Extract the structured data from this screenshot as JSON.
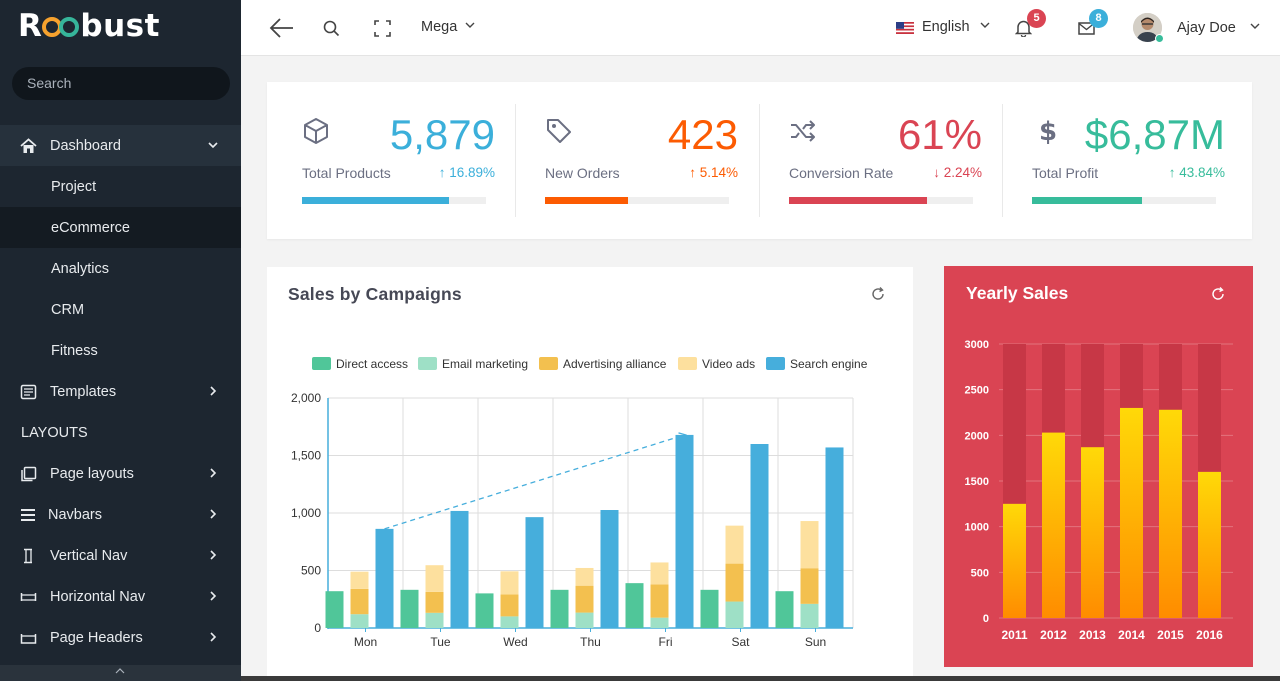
{
  "brand": {
    "logo_text_prefix": "R",
    "logo_text_suffix": "bust"
  },
  "sidebar": {
    "search_placeholder": "Search",
    "items": [
      {
        "label": "Dashboard",
        "icon": "home-icon",
        "chevron": "down"
      },
      {
        "label": "Project"
      },
      {
        "label": "eCommerce",
        "active": true
      },
      {
        "label": "Analytics"
      },
      {
        "label": "CRM"
      },
      {
        "label": "Fitness"
      },
      {
        "label": "Templates",
        "icon": "templates-icon",
        "chevron": "right"
      },
      {
        "label": "LAYOUTS",
        "category": true
      },
      {
        "label": "Page layouts",
        "icon": "copy-icon",
        "chevron": "right"
      },
      {
        "label": "Navbars",
        "icon": "menu-icon",
        "chevron": "right"
      },
      {
        "label": "Vertical Nav",
        "icon": "vertical-nav-icon",
        "chevron": "right"
      },
      {
        "label": "Horizontal Nav",
        "icon": "horizontal-nav-icon",
        "chevron": "right"
      },
      {
        "label": "Page Headers",
        "icon": "page-headers-icon",
        "chevron": "right"
      }
    ]
  },
  "header": {
    "mega_label": "Mega",
    "language": "English",
    "notifications_count": "5",
    "messages_count": "8",
    "user_name": "Ajay Doe"
  },
  "stats": [
    {
      "value": "5,879",
      "label": "Total Products",
      "change": "16.89%",
      "direction": "up",
      "color": "#3bafda",
      "progress": 0.8,
      "icon": "cube-icon"
    },
    {
      "value": "423",
      "label": "New Orders",
      "change": "5.14%",
      "direction": "up",
      "color": "#fc5b02",
      "progress": 0.45,
      "icon": "tag-icon"
    },
    {
      "value": "61%",
      "label": "Conversion Rate",
      "change": "2.24%",
      "direction": "down",
      "color": "#da4453",
      "progress": 0.75,
      "icon": "shuffle-icon"
    },
    {
      "value": "$6,87M",
      "label": "Total Profit",
      "change": "43.84%",
      "direction": "up",
      "color": "#37bc9b",
      "progress": 0.6,
      "icon": "dollar-icon"
    }
  ],
  "campaigns": {
    "title": "Sales by Campaigns",
    "chart_data": {
      "type": "bar",
      "categories": [
        "Mon",
        "Tue",
        "Wed",
        "Thu",
        "Fri",
        "Sat",
        "Sun"
      ],
      "series": [
        {
          "name": "Direct access",
          "color": "#50c699",
          "values": [
            320,
            332,
            301,
            332,
            390,
            332,
            320
          ]
        },
        {
          "name": "Email marketing",
          "color": "#9ee0c6",
          "values": [
            120,
            132,
            101,
            134,
            90,
            230,
            210
          ]
        },
        {
          "name": "Advertising alliance",
          "color": "#f3c04f",
          "values": [
            220,
            182,
            191,
            234,
            290,
            330,
            310
          ]
        },
        {
          "name": "Video ads",
          "color": "#fde09e",
          "values": [
            150,
            232,
            201,
            154,
            190,
            330,
            410
          ]
        },
        {
          "name": "Search engine",
          "color": "#46aedc",
          "values": [
            862,
            1018,
            964,
            1026,
            1679,
            1600,
            1570
          ]
        }
      ],
      "stacked_series": [
        "Email marketing",
        "Advertising alliance",
        "Video ads"
      ],
      "trend_line": {
        "from": "Mon",
        "to": "Fri",
        "y_from": 862,
        "y_to": 1679
      },
      "yticks": [
        "2,000",
        "1,500",
        "1,000",
        "500",
        "0"
      ],
      "ylim": [
        0,
        2000
      ],
      "grid": true,
      "legend": "top"
    }
  },
  "yearly": {
    "title": "Yearly Sales",
    "color": "#da4453",
    "chart_data": {
      "type": "bar",
      "categories": [
        "2011",
        "2012",
        "2013",
        "2014",
        "2015",
        "2016"
      ],
      "values": [
        1250,
        2030,
        1870,
        2300,
        2280,
        1600
      ],
      "max_background": 3000,
      "yticks": [
        "3000",
        "2500",
        "2000",
        "1500",
        "1000",
        "500",
        "0"
      ],
      "ylim": [
        0,
        3000
      ]
    }
  }
}
